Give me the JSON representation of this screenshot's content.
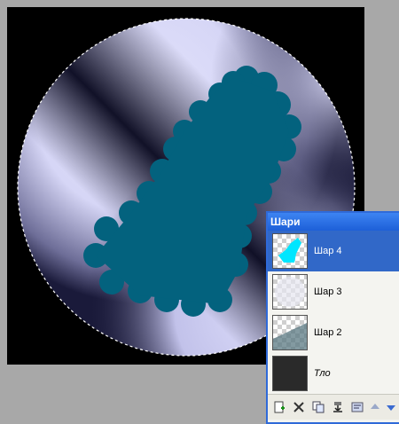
{
  "panel": {
    "title": "Шари"
  },
  "layers": [
    {
      "label": "Шар 4",
      "selected": true
    },
    {
      "label": "Шар 3",
      "selected": false
    },
    {
      "label": "Шар 2",
      "selected": false
    },
    {
      "label": "Тло",
      "selected": false
    }
  ],
  "toolbar": {
    "buttons": [
      "add-layer",
      "delete-layer",
      "duplicate-layer",
      "merge-layer-down",
      "layer-properties",
      "move-layer-up",
      "move-layer-down"
    ]
  },
  "colors": {
    "sphere_highlight": "#dcdcfa",
    "sphere_shadow": "#0a0a30",
    "paint_teal": "#03627e",
    "selection_accent": "#3168c8",
    "titlebar": "#2f6ad9"
  }
}
